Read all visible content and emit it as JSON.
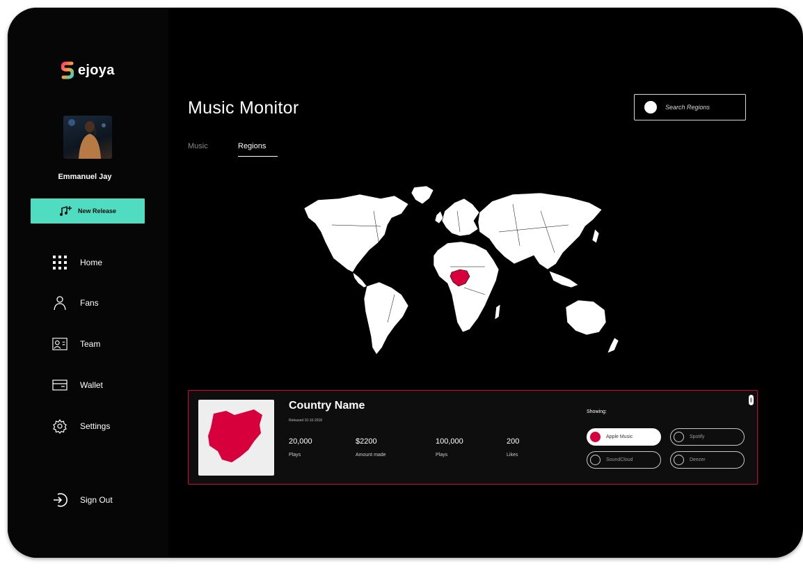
{
  "brand": {
    "name": "ejoya"
  },
  "user": {
    "name": "Emmanuel Jay"
  },
  "sidebar": {
    "new_release_label": "New Release",
    "items": [
      {
        "label": "Home",
        "icon": "grid-icon"
      },
      {
        "label": "Fans",
        "icon": "person-icon"
      },
      {
        "label": "Team",
        "icon": "id-card-icon"
      },
      {
        "label": "Wallet",
        "icon": "wallet-icon"
      },
      {
        "label": "Settings",
        "icon": "gear-icon"
      }
    ],
    "sign_out_label": "Sign Out"
  },
  "header": {
    "title": "Music Monitor"
  },
  "search": {
    "placeholder": "Search Regions"
  },
  "tabs": [
    {
      "label": "Music",
      "active": false
    },
    {
      "label": "Regions",
      "active": true
    }
  ],
  "map": {
    "highlighted_region": "Nigeria",
    "highlight_color": "#d8003c"
  },
  "card": {
    "country_name": "Country Name",
    "released": "Released 10-10-2018",
    "stats": [
      {
        "value": "20,000",
        "label": "Plays"
      },
      {
        "value": "$2200",
        "label": "Amount made"
      },
      {
        "value": "100,000",
        "label": "Plays"
      },
      {
        "value": "200",
        "label": "Likes"
      }
    ],
    "showing_label": "Showing:",
    "platforms": [
      {
        "label": "Apple Music",
        "selected": true
      },
      {
        "label": "Spotify",
        "selected": false
      },
      {
        "label": "SoundCloud",
        "selected": false
      },
      {
        "label": "Deezer",
        "selected": false
      }
    ]
  },
  "colors": {
    "accent": "#4fdcc0",
    "highlight": "#d8003c",
    "background": "#000000"
  }
}
